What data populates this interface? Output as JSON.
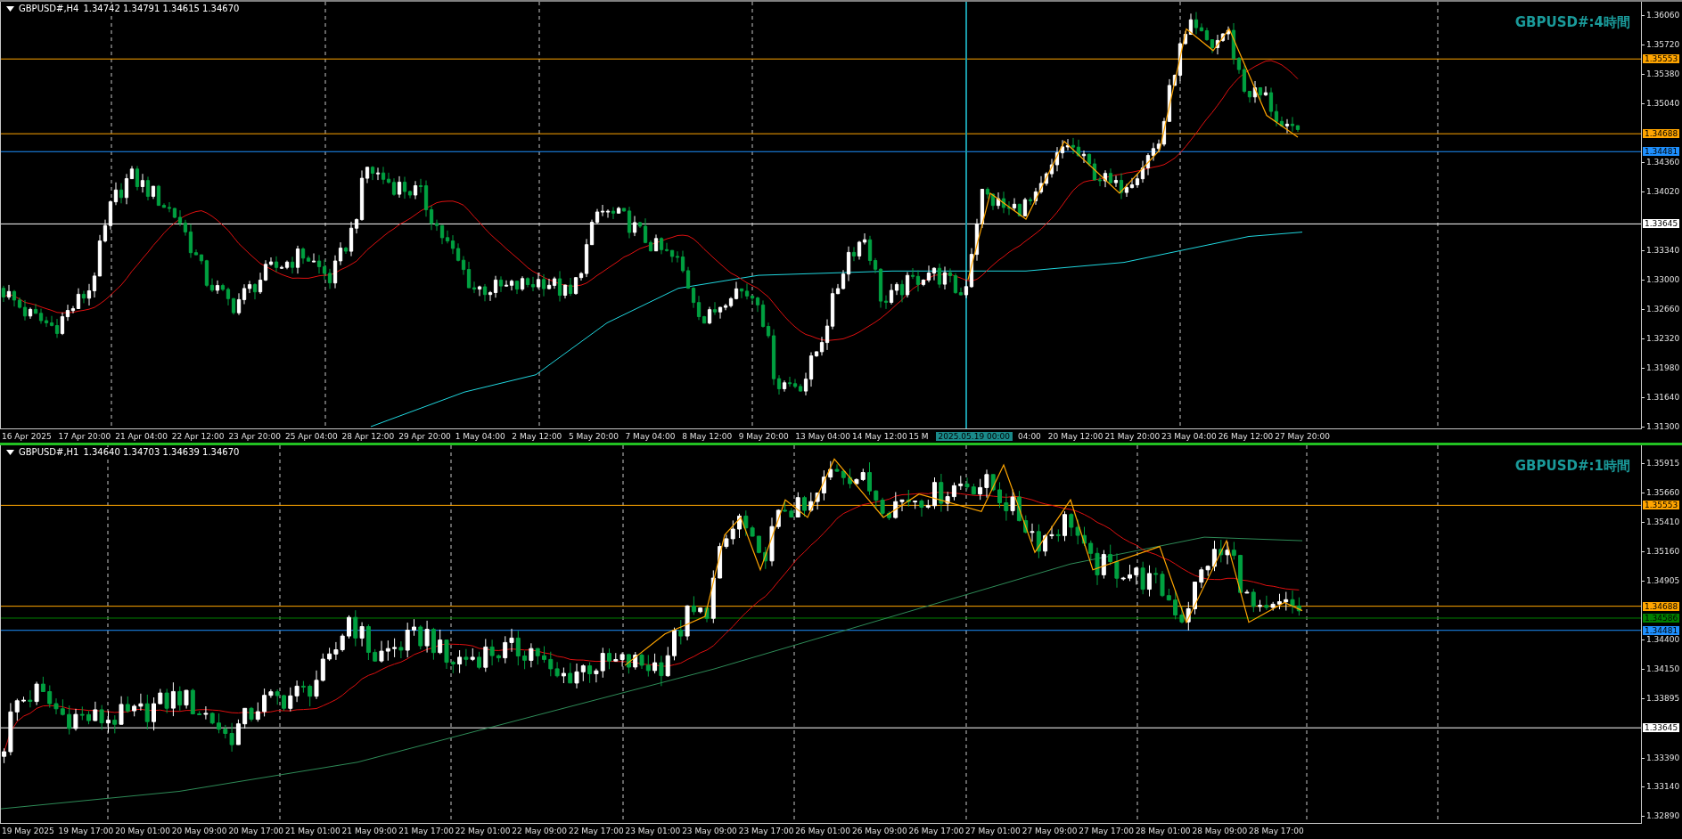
{
  "charts": [
    {
      "header": {
        "symbol": "GBPUSD#,H4",
        "ohlc": "1.34742 1.34791 1.34615 1.34670"
      },
      "title": "GBPUSD#:4時間",
      "price_ticks": [
        "1.36060",
        "1.35720",
        "1.35380",
        "1.35040",
        "1.34360",
        "1.34020",
        "1.33340",
        "1.33000",
        "1.32660",
        "1.32320",
        "1.31980",
        "1.31640",
        "1.31300"
      ],
      "levels": [
        {
          "price": "1.35553",
          "color": "#ffa500"
        },
        {
          "price": "1.34688",
          "color": "#ffa500"
        },
        {
          "price": "1.34481",
          "color": "#1e90ff"
        },
        {
          "price": "1.33645",
          "color": "#ffffff"
        }
      ],
      "time_labels": [
        {
          "text": "16 Apr 2025",
          "kind": "tick"
        },
        {
          "text": "17 Apr 20:00",
          "kind": "tick"
        },
        {
          "text": "21 Apr 04:00",
          "kind": "tick"
        },
        {
          "text": "22 Apr 12:00",
          "kind": "tick"
        },
        {
          "text": "23 Apr 20:00",
          "kind": "tick"
        },
        {
          "text": "25 Apr 04:00",
          "kind": "tick"
        },
        {
          "text": "28 Apr 12:00",
          "kind": "tick"
        },
        {
          "text": "29 Apr 20:00",
          "kind": "tick"
        },
        {
          "text": "1 May 04:00",
          "kind": "tick"
        },
        {
          "text": "2 May 12:00",
          "kind": "tick"
        },
        {
          "text": "5 May 20:00",
          "kind": "tick"
        },
        {
          "text": "7 May 04:00",
          "kind": "tick"
        },
        {
          "text": "8 May 12:00",
          "kind": "tick"
        },
        {
          "text": "9 May 20:00",
          "kind": "tick"
        },
        {
          "text": "13 May 04:00",
          "kind": "tick"
        },
        {
          "text": "14 May 12:00",
          "kind": "tick"
        },
        {
          "text": "15 M",
          "kind": "partial"
        },
        {
          "text": "2025.05.19 00:00",
          "kind": "crosshair"
        },
        {
          "text": "04:00",
          "kind": "partial"
        },
        {
          "text": "20 May 12:00",
          "kind": "tick"
        },
        {
          "text": "21 May 20:00",
          "kind": "tick"
        },
        {
          "text": "23 May 04:00",
          "kind": "tick"
        },
        {
          "text": "26 May 12:00",
          "kind": "tick"
        },
        {
          "text": "27 May 20:00",
          "kind": "tick"
        }
      ]
    },
    {
      "header": {
        "symbol": "GBPUSD#,H1",
        "ohlc": "1.34640 1.34703 1.34639 1.34670"
      },
      "title": "GBPUSD#:1時間",
      "price_ticks": [
        "1.35915",
        "1.35660",
        "1.35410",
        "1.35160",
        "1.34905",
        "1.34400",
        "1.34150",
        "1.33895",
        "1.33390",
        "1.33140",
        "1.32890"
      ],
      "levels": [
        {
          "price": "1.35553",
          "color": "#ffa500"
        },
        {
          "price": "1.34688",
          "color": "#ffa500"
        },
        {
          "price": "1.34586",
          "color": "#008000"
        },
        {
          "price": "1.34481",
          "color": "#1e90ff"
        },
        {
          "price": "1.33645",
          "color": "#ffffff"
        }
      ],
      "time_labels": [
        {
          "text": "19 May 2025",
          "kind": "tick"
        },
        {
          "text": "19 May 17:00",
          "kind": "tick"
        },
        {
          "text": "20 May 01:00",
          "kind": "tick"
        },
        {
          "text": "20 May 09:00",
          "kind": "tick"
        },
        {
          "text": "20 May 17:00",
          "kind": "tick"
        },
        {
          "text": "21 May 01:00",
          "kind": "tick"
        },
        {
          "text": "21 May 09:00",
          "kind": "tick"
        },
        {
          "text": "21 May 17:00",
          "kind": "tick"
        },
        {
          "text": "22 May 01:00",
          "kind": "tick"
        },
        {
          "text": "22 May 09:00",
          "kind": "tick"
        },
        {
          "text": "22 May 17:00",
          "kind": "tick"
        },
        {
          "text": "23 May 01:00",
          "kind": "tick"
        },
        {
          "text": "23 May 09:00",
          "kind": "tick"
        },
        {
          "text": "23 May 17:00",
          "kind": "tick"
        },
        {
          "text": "26 May 01:00",
          "kind": "tick"
        },
        {
          "text": "26 May 09:00",
          "kind": "tick"
        },
        {
          "text": "26 May 17:00",
          "kind": "tick"
        },
        {
          "text": "27 May 01:00",
          "kind": "tick"
        },
        {
          "text": "27 May 09:00",
          "kind": "tick"
        },
        {
          "text": "27 May 17:00",
          "kind": "tick"
        },
        {
          "text": "28 May 01:00",
          "kind": "tick"
        },
        {
          "text": "28 May 09:00",
          "kind": "tick"
        },
        {
          "text": "28 May 17:00",
          "kind": "tick"
        }
      ]
    }
  ]
}
